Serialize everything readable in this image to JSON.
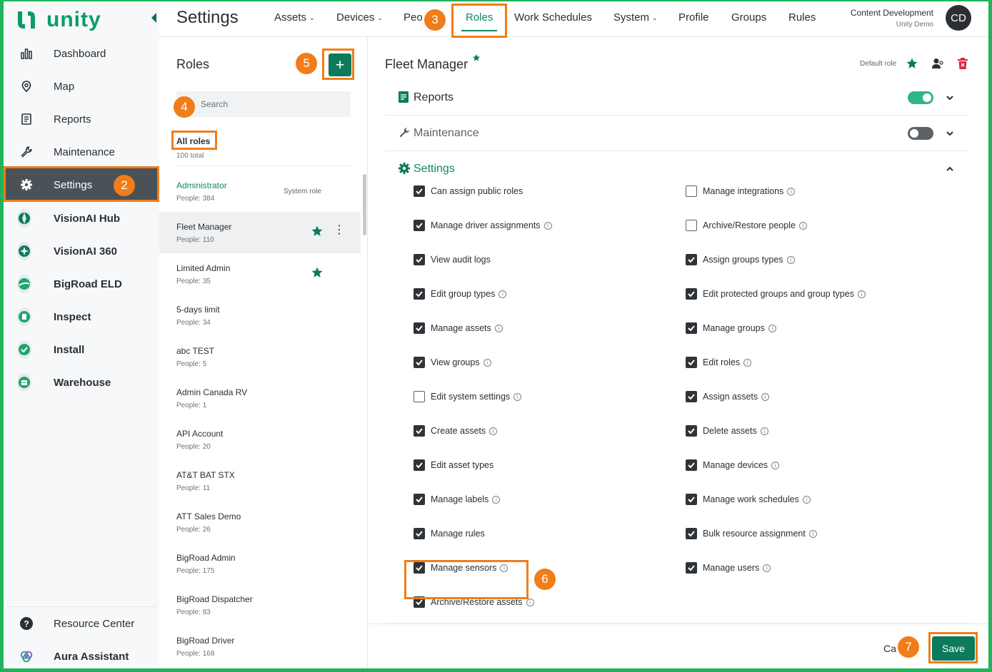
{
  "brand": {
    "name": "unity"
  },
  "nav": {
    "items": [
      {
        "label": "Dashboard",
        "icon": "bar-chart-icon"
      },
      {
        "label": "Map",
        "icon": "map-pin-icon"
      },
      {
        "label": "Reports",
        "icon": "report-icon"
      },
      {
        "label": "Maintenance",
        "icon": "wrench-icon"
      },
      {
        "label": "Settings",
        "icon": "gear-icon",
        "active": true
      },
      {
        "label": "VisionAI Hub",
        "icon": "visionai-hub-icon"
      },
      {
        "label": "VisionAI 360",
        "icon": "visionai-360-icon"
      },
      {
        "label": "BigRoad ELD",
        "icon": "bigroad-eld-icon"
      },
      {
        "label": "Inspect",
        "icon": "inspect-icon"
      },
      {
        "label": "Install",
        "icon": "install-icon"
      },
      {
        "label": "Warehouse",
        "icon": "warehouse-icon"
      }
    ],
    "bottom": [
      {
        "label": "Resource Center",
        "icon": "help-icon"
      },
      {
        "label": "Aura Assistant",
        "icon": "aura-icon"
      }
    ]
  },
  "topbar": {
    "title": "Settings",
    "tabs": [
      "Assets",
      "Devices",
      "Peo",
      "Roles",
      "Work Schedules",
      "System",
      "Profile",
      "Groups",
      "Rules"
    ],
    "active_tab": "Roles",
    "user_name": "Content Development",
    "user_org": "Unity Demo",
    "avatar": "CD"
  },
  "roles": {
    "title": "Roles",
    "add_label": "+",
    "search_placeholder": "Search",
    "filter_label": "All roles",
    "filter_count": "100 total",
    "list": [
      {
        "name": "Administrator",
        "people": "People: 384",
        "tag": "System role"
      },
      {
        "name": "Fleet Manager",
        "people": "People: 110",
        "starred": true,
        "selected": true
      },
      {
        "name": "Limited Admin",
        "people": "People: 35",
        "starred": true
      },
      {
        "name": "5-days limit",
        "people": "People: 34"
      },
      {
        "name": "abc TEST",
        "people": "People: 5"
      },
      {
        "name": "Admin Canada RV",
        "people": "People: 1"
      },
      {
        "name": "API Account",
        "people": "People: 20"
      },
      {
        "name": "AT&T BAT STX",
        "people": "People: 11"
      },
      {
        "name": "ATT Sales Demo",
        "people": "People: 26"
      },
      {
        "name": "BigRoad Admin",
        "people": "People: 175"
      },
      {
        "name": "BigRoad Dispatcher",
        "people": "People: 83"
      },
      {
        "name": "BigRoad Driver",
        "people": "People: 168"
      }
    ]
  },
  "detail": {
    "title": "Fleet Manager",
    "default_role_label": "Default role",
    "sections": [
      {
        "label": "Reports",
        "enabled": true
      },
      {
        "label": "Maintenance",
        "enabled": false
      },
      {
        "label": "Settings",
        "expanded": true
      }
    ],
    "permissions_left": [
      {
        "label": "Can assign public roles",
        "checked": true,
        "info": false
      },
      {
        "label": "Manage driver assignments",
        "checked": true,
        "info": true
      },
      {
        "label": "View audit logs",
        "checked": true,
        "info": false
      },
      {
        "label": "Edit group types",
        "checked": true,
        "info": true
      },
      {
        "label": "Manage assets",
        "checked": true,
        "info": true
      },
      {
        "label": "View groups",
        "checked": true,
        "info": true
      },
      {
        "label": "Edit system settings",
        "checked": false,
        "info": true
      },
      {
        "label": "Create assets",
        "checked": true,
        "info": true
      },
      {
        "label": "Edit asset types",
        "checked": true,
        "info": false
      },
      {
        "label": "Manage labels",
        "checked": true,
        "info": true
      },
      {
        "label": "Manage rules",
        "checked": true,
        "info": false
      },
      {
        "label": "Manage sensors",
        "checked": true,
        "info": true
      },
      {
        "label": "Archive/Restore assets",
        "checked": true,
        "info": true
      }
    ],
    "permissions_right": [
      {
        "label": "Manage integrations",
        "checked": false,
        "info": true
      },
      {
        "label": "Archive/Restore people",
        "checked": false,
        "info": true
      },
      {
        "label": "Assign groups types",
        "checked": true,
        "info": true
      },
      {
        "label": "Edit protected groups and group types",
        "checked": true,
        "info": true
      },
      {
        "label": "Manage groups",
        "checked": true,
        "info": true
      },
      {
        "label": "Edit roles",
        "checked": true,
        "info": true
      },
      {
        "label": "Assign assets",
        "checked": true,
        "info": true
      },
      {
        "label": "Delete assets",
        "checked": true,
        "info": true
      },
      {
        "label": "Manage devices",
        "checked": true,
        "info": true
      },
      {
        "label": "Manage work schedules",
        "checked": true,
        "info": true
      },
      {
        "label": "Bulk resource assignment",
        "checked": true,
        "info": true
      },
      {
        "label": "Manage users",
        "checked": true,
        "info": true
      }
    ],
    "cancel_label": "Ca",
    "save_label": "Save"
  },
  "annotations": {
    "badges": [
      "2",
      "3",
      "4",
      "5",
      "6",
      "7"
    ]
  },
  "colors": {
    "accent": "#0d8a63",
    "primary_button": "#0d7a5c",
    "highlight": "#f07d1a",
    "frame": "#1fb35b",
    "active_nav": "#4a5257"
  }
}
